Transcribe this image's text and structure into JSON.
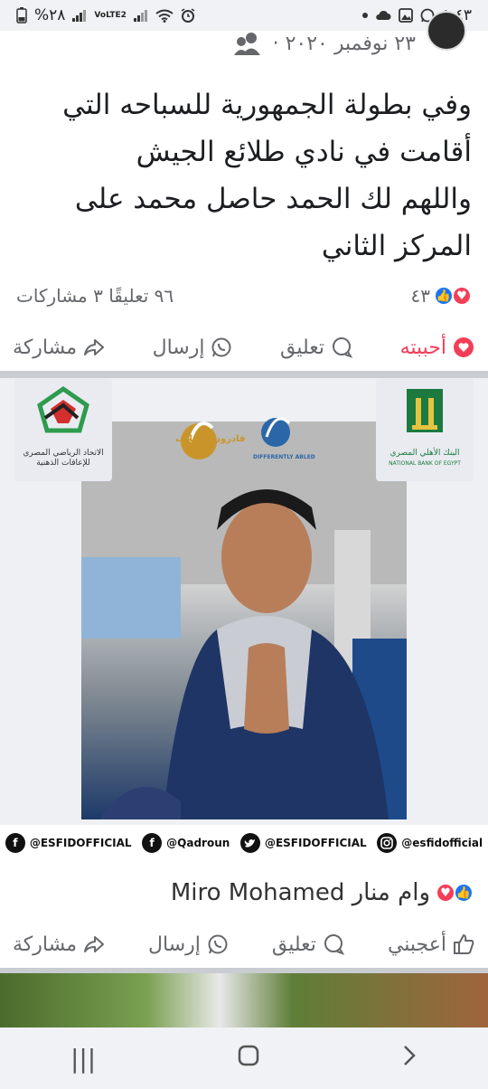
{
  "status_bar": {
    "time": "٨:٤٣",
    "battery": "%٢٨",
    "network_label": "VoLTE2"
  },
  "post": {
    "date": "٢٣ نوفمبر ٢٠٢٠ ·",
    "text_lines": [
      "وفي بطولة الجمهورية للسباحه التي",
      "أقامت في نادي طلائع الجيش",
      "واللهم لك الحمد حاصل محمد على",
      "المركز الثاني"
    ],
    "reactions_count": "٤٣",
    "comments_shares": "٩٦ تعليقًا ٣ مشاركات",
    "actions": {
      "like": "أحببته",
      "comment": "تعليق",
      "send": "إرسال",
      "share": "مشاركة"
    },
    "image": {
      "logo_left_caption_1": "الاتحاد الرياضي المصري",
      "logo_left_caption_2": "للإعاقات الذهنية",
      "logo_center_1": "قادرون باختلاف",
      "logo_center_2": "DIFFERENTLY ABLED",
      "logo_right_caption_1": "البنك الأهلي المصري",
      "logo_right_caption_2": "NATIONAL BANK OF EGYPT",
      "socials": [
        {
          "handle": "@ESFIDOFFICIAL",
          "icon": "facebook-icon"
        },
        {
          "handle": "@Qadroun",
          "icon": "facebook-icon"
        },
        {
          "handle": "@ESFIDOFFICIAL",
          "icon": "twitter-icon"
        },
        {
          "handle": "@esfidofficial",
          "icon": "instagram-icon"
        }
      ]
    }
  },
  "post2": {
    "reactors_text": "وام منار Miro Mohamed",
    "actions": {
      "like": "أعجبني",
      "comment": "تعليق",
      "send": "إرسال",
      "share": "مشاركة"
    }
  },
  "nav": {
    "recent": "|||",
    "home": "○",
    "back": "›"
  },
  "colors": {
    "love": "#f33e58",
    "like": "#1877f2",
    "muted": "#65676b"
  }
}
